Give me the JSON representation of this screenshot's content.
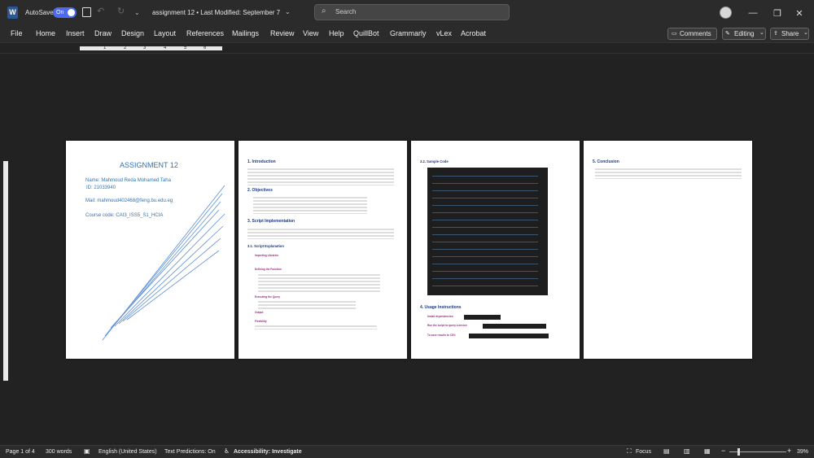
{
  "titlebar": {
    "autosave_label": "AutoSave",
    "autosave_state": "On",
    "doc_title": "assignment 12 • Last Modified: September 7",
    "search_placeholder": "Search"
  },
  "menu": [
    "File",
    "Home",
    "Insert",
    "Draw",
    "Design",
    "Layout",
    "References",
    "Mailings",
    "Review",
    "View",
    "Help",
    "QuillBot",
    "Grammarly",
    "vLex",
    "Acrobat"
  ],
  "actions": {
    "comments": "Comments",
    "editing": "Editing",
    "share": "Share"
  },
  "ruler_marks": [
    "1",
    "2",
    "3",
    "4",
    "5",
    "6"
  ],
  "pages": {
    "p1": {
      "title": "ASSIGNMENT 12",
      "name": "Name: Mahmoud Reda Mohamed Taha",
      "id": "ID: 21033940",
      "mail": "Mail: mahmoud402468@feng.bu.edu.eg",
      "course": "Course code: CAI3_ISS5_S1_HCIA"
    },
    "p2": {
      "h_intro": "1. Introduction",
      "h_obj": "2. Objectives",
      "h_impl": "3. Script Implementation",
      "h_expl": "3.1. Script Explanation",
      "items": [
        "Importing Libraries",
        "Defining the Function",
        "Executing the Query",
        "Output",
        "Flexibility"
      ]
    },
    "p3": {
      "h_code": "3.2. Sample Code",
      "h_usage": "4. Usage Instructions",
      "steps": [
        "Install dependencies:",
        "Run the script to query a device:",
        "To save results to CSV:"
      ]
    },
    "p4": {
      "h_concl": "5. Conclusion"
    }
  },
  "status": {
    "page": "Page 1 of 4",
    "words": "300 words",
    "lang": "English (United States)",
    "predict": "Text Predictions: On",
    "access": "Accessibility: Investigate",
    "focus": "Focus",
    "zoom": "39%"
  }
}
